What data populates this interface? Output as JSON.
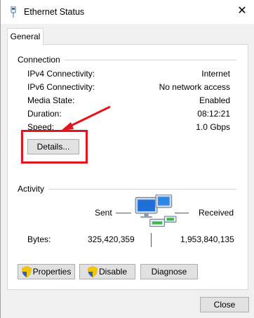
{
  "window": {
    "title": "Ethernet Status",
    "close_glyph": "✕"
  },
  "tabs": [
    {
      "label": "General",
      "selected": true
    }
  ],
  "connection": {
    "group_label": "Connection",
    "rows": [
      {
        "label": "IPv4 Connectivity:",
        "value": "Internet"
      },
      {
        "label": "IPv6 Connectivity:",
        "value": "No network access"
      },
      {
        "label": "Media State:",
        "value": "Enabled"
      },
      {
        "label": "Duration:",
        "value": "08:12:21"
      },
      {
        "label": "Speed:",
        "value": "1.0 Gbps"
      }
    ],
    "details_button": "Details..."
  },
  "activity": {
    "group_label": "Activity",
    "sent_label": "Sent",
    "received_label": "Received",
    "bytes_label": "Bytes:",
    "bytes_sent": "325,420,359",
    "bytes_received": "1,953,840,135",
    "icon": "network-computers-icon"
  },
  "buttons": {
    "properties": "Properties",
    "disable": "Disable",
    "diagnose": "Diagnose",
    "close": "Close"
  },
  "annotation": {
    "highlight_color": "#e3141b"
  }
}
